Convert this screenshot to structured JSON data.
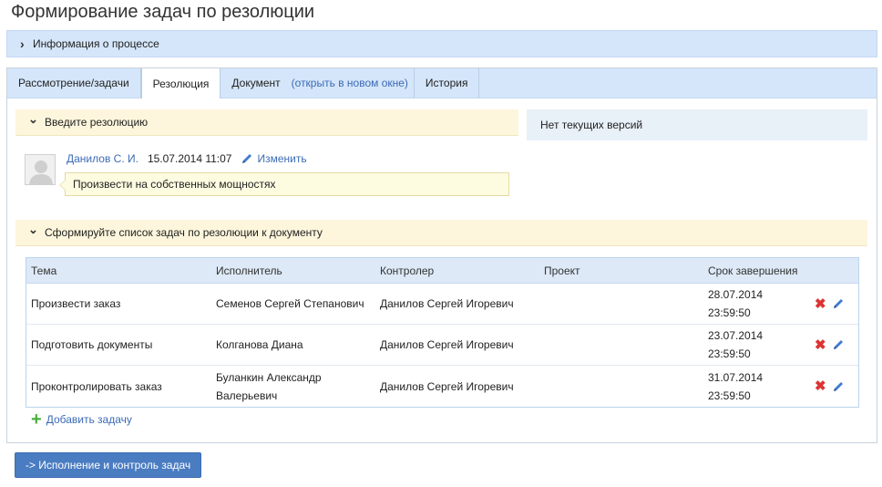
{
  "page": {
    "title": "Формирование задач по резолюции"
  },
  "process_info": {
    "label": "Информация о процессе"
  },
  "tabs": [
    {
      "label": "Рассмотрение/задачи"
    },
    {
      "label": "Резолюция"
    },
    {
      "label": "Документ",
      "extra_link": "(открыть в новом окне)"
    },
    {
      "label": "История"
    }
  ],
  "resolution": {
    "header": "Введите резолюцию",
    "author": "Данилов С. И.",
    "datetime": "15.07.2014 11:07",
    "edit_label": "Изменить",
    "text": "Произвести на собственных мощностях"
  },
  "versions": {
    "label": "Нет текущих версий"
  },
  "tasks_section": {
    "header": "Сформируйте список задач по резолюции к документу",
    "columns": [
      "Тема",
      "Исполнитель",
      "Контролер",
      "Проект",
      "Срок завершения"
    ],
    "rows": [
      {
        "topic": "Произвести заказ",
        "executor": "Семенов Сергей Степанович",
        "controller": "Данилов Сергей Игоревич",
        "project": "",
        "deadline_date": "28.07.2014",
        "deadline_time": "23:59:50"
      },
      {
        "topic": "Подготовить документы",
        "executor": "Колганова Диана",
        "controller": "Данилов Сергей Игоревич",
        "project": "",
        "deadline_date": "23.07.2014",
        "deadline_time": "23:59:50"
      },
      {
        "topic": "Проконтролировать заказ",
        "executor": "Буланкин Александр Валерьевич",
        "controller": "Данилов Сергей Игоревич",
        "project": "",
        "deadline_date": "31.07.2014",
        "deadline_time": "23:59:50"
      }
    ],
    "add_label": "Добавить задачу"
  },
  "action_button": {
    "label": "-> Исполнение и контроль задач"
  },
  "colors": {
    "accent": "#4a7cc2",
    "link": "#3b6bb5",
    "header_blue": "#d5e6fa",
    "section_yellow": "#fdf6dc",
    "delete_red": "#dd3333",
    "add_green": "#4caf3f"
  }
}
